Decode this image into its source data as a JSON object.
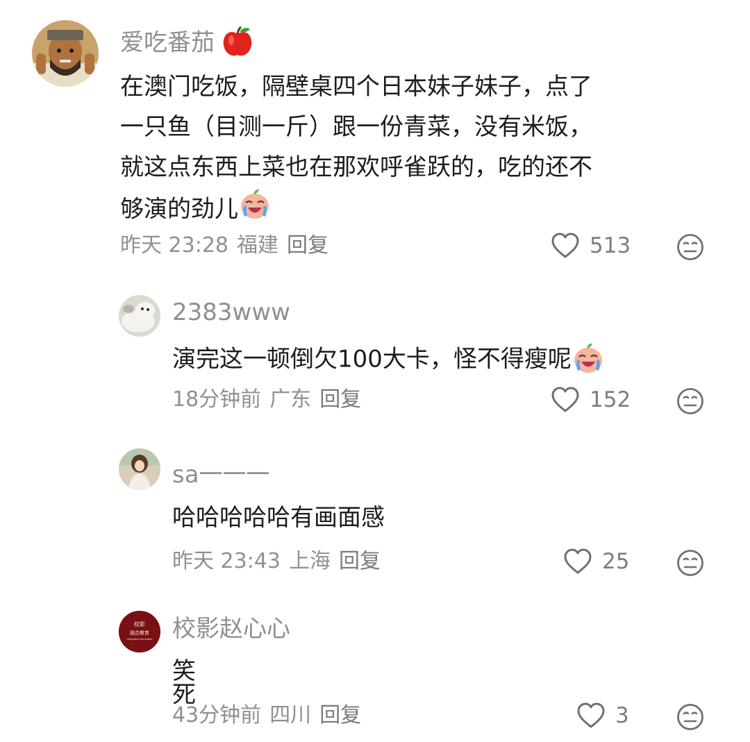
{
  "comments": [
    {
      "username": "爱吃番茄",
      "username_emoji": "apple-emoji",
      "text": "在澳门吃饭，隔壁桌四个日本妹子妹子，点了一只鱼（目测一斤）跟一份青菜，没有米饭，就这点东西上菜也在那欢呼雀跃的，吃的还不够演的劲儿",
      "text_lines": [
        "在澳门吃饭，隔壁桌四个日本妹子妹子，点了",
        "一只鱼（目测一斤）跟一份青菜，没有米饭，",
        "就这点东西上菜也在那欢呼雀跃的，吃的还不",
        "够演的劲儿"
      ],
      "trailing_emoji": "crying-laugh-emoji",
      "time": "昨天 23:28",
      "location": "福建",
      "reply_label": "回复",
      "likes": "513"
    }
  ],
  "replies": [
    {
      "username": "2383www",
      "text": "演完这一顿倒欠100大卡，怪不得瘦呢",
      "trailing_emoji": "crying-laugh-emoji",
      "time": "18分钟前",
      "location": "广东",
      "reply_label": "回复",
      "likes": "152"
    },
    {
      "username": "sa一一一",
      "text": "哈哈哈哈哈有画面感",
      "time": "昨天 23:43",
      "location": "上海",
      "reply_label": "回复",
      "likes": "25"
    },
    {
      "username": "校影赵心心",
      "avatar_text": [
        "校影",
        "融合教育",
        "integrated education"
      ],
      "text": "笑死",
      "time": "43分钟前",
      "location": "四川",
      "reply_label": "回复",
      "likes": "3"
    }
  ],
  "colors": {
    "username": "#8f8f8f",
    "meta": "#909090",
    "text": "#1c1c1c",
    "icon": "#6f6f6f",
    "avatar_brand": "#7a1014"
  }
}
